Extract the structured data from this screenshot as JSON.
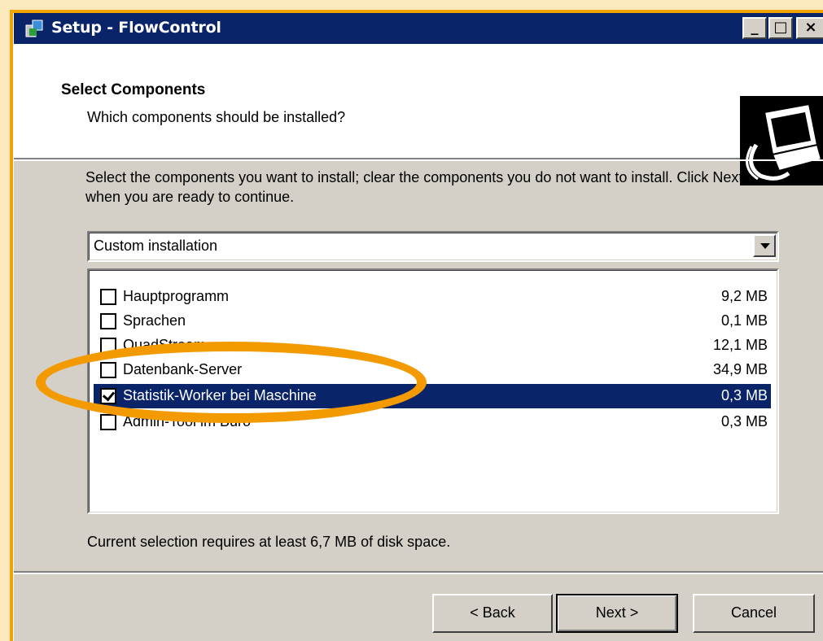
{
  "window": {
    "title": "Setup - FlowControl"
  },
  "header": {
    "title": "Select Components",
    "subtitle": "Which components should be installed?",
    "graphic_icon": "computer-installer-icon"
  },
  "description": "Select the components you want to install; clear the components you do not want to install. Click Next when you are ready to continue.",
  "install_type": {
    "selected": "Custom installation"
  },
  "components": [
    {
      "label": "Hauptprogramm",
      "size": "9,2 MB",
      "checked": false,
      "selected": false
    },
    {
      "label": "Sprachen",
      "size": "0,1 MB",
      "checked": false,
      "selected": false
    },
    {
      "label": "QuadStream",
      "size": "12,1 MB",
      "checked": false,
      "selected": false
    },
    {
      "label": "Datenbank-Server",
      "size": "34,9 MB",
      "checked": false,
      "selected": false
    },
    {
      "label": "Statistik-Worker bei Maschine",
      "size": "0,3 MB",
      "checked": true,
      "selected": true
    },
    {
      "label": "Admin-Tool im Büro",
      "size": "0,3 MB",
      "checked": false,
      "selected": false
    }
  ],
  "space_required": "Current selection requires at least 6,7 MB of disk space.",
  "buttons": {
    "back": "< Back",
    "next": "Next >",
    "cancel": "Cancel"
  },
  "colors": {
    "highlight_ellipse": "#f39a00",
    "selection": "#0a246a",
    "titlebar": "#0a246a"
  }
}
